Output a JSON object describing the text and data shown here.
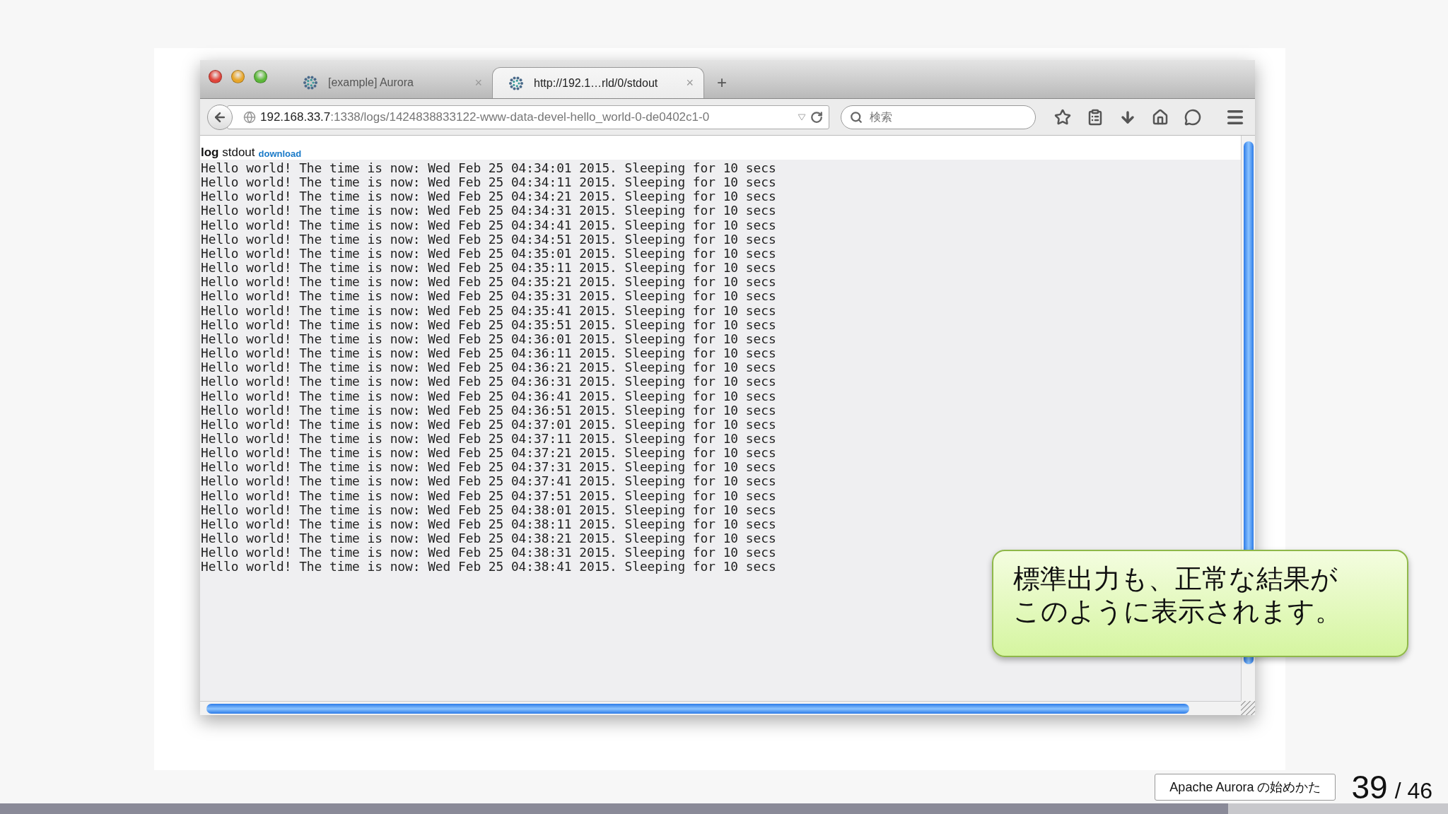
{
  "browser": {
    "tabs": [
      {
        "label": "[example] Aurora",
        "close": "×",
        "selected": false
      },
      {
        "label": "http://192.1…rld/0/stdout",
        "close": "×",
        "selected": true
      }
    ],
    "new_tab": "+",
    "address": {
      "host": "192.168.33.7",
      "path": ":1338/logs/1424838833122-www-data-devel-hello_world-0-de0402c1-0"
    },
    "search": {
      "placeholder": "検索"
    }
  },
  "page": {
    "title": "**log** stdout",
    "link": "download",
    "lines": [
      "Hello world! The time is now: Wed Feb 25 04:34:01 2015. Sleeping for 10 secs",
      "Hello world! The time is now: Wed Feb 25 04:34:11 2015. Sleeping for 10 secs",
      "Hello world! The time is now: Wed Feb 25 04:34:21 2015. Sleeping for 10 secs",
      "Hello world! The time is now: Wed Feb 25 04:34:31 2015. Sleeping for 10 secs",
      "Hello world! The time is now: Wed Feb 25 04:34:41 2015. Sleeping for 10 secs",
      "Hello world! The time is now: Wed Feb 25 04:34:51 2015. Sleeping for 10 secs",
      "Hello world! The time is now: Wed Feb 25 04:35:01 2015. Sleeping for 10 secs",
      "Hello world! The time is now: Wed Feb 25 04:35:11 2015. Sleeping for 10 secs",
      "Hello world! The time is now: Wed Feb 25 04:35:21 2015. Sleeping for 10 secs",
      "Hello world! The time is now: Wed Feb 25 04:35:31 2015. Sleeping for 10 secs",
      "Hello world! The time is now: Wed Feb 25 04:35:41 2015. Sleeping for 10 secs",
      "Hello world! The time is now: Wed Feb 25 04:35:51 2015. Sleeping for 10 secs",
      "Hello world! The time is now: Wed Feb 25 04:36:01 2015. Sleeping for 10 secs",
      "Hello world! The time is now: Wed Feb 25 04:36:11 2015. Sleeping for 10 secs",
      "Hello world! The time is now: Wed Feb 25 04:36:21 2015. Sleeping for 10 secs",
      "Hello world! The time is now: Wed Feb 25 04:36:31 2015. Sleeping for 10 secs",
      "Hello world! The time is now: Wed Feb 25 04:36:41 2015. Sleeping for 10 secs",
      "Hello world! The time is now: Wed Feb 25 04:36:51 2015. Sleeping for 10 secs",
      "Hello world! The time is now: Wed Feb 25 04:37:01 2015. Sleeping for 10 secs",
      "Hello world! The time is now: Wed Feb 25 04:37:11 2015. Sleeping for 10 secs",
      "Hello world! The time is now: Wed Feb 25 04:37:21 2015. Sleeping for 10 secs",
      "Hello world! The time is now: Wed Feb 25 04:37:31 2015. Sleeping for 10 secs",
      "Hello world! The time is now: Wed Feb 25 04:37:41 2015. Sleeping for 10 secs",
      "Hello world! The time is now: Wed Feb 25 04:37:51 2015. Sleeping for 10 secs",
      "Hello world! The time is now: Wed Feb 25 04:38:01 2015. Sleeping for 10 secs",
      "Hello world! The time is now: Wed Feb 25 04:38:11 2015. Sleeping for 10 secs",
      "Hello world! The time is now: Wed Feb 25 04:38:21 2015. Sleeping for 10 secs",
      "Hello world! The time is now: Wed Feb 25 04:38:31 2015. Sleeping for 10 secs",
      "Hello world! The time is now: Wed Feb 25 04:38:41 2015. Sleeping for 10 secs"
    ]
  },
  "callout": {
    "lines": [
      "標準出力も、正常な結果が",
      "このように表示されます。"
    ]
  },
  "footer": {
    "deck_title": "Apache Aurora の始めかた",
    "page": "39",
    "total": "/ 46",
    "progress": {
      "level": 0.848
    }
  }
}
